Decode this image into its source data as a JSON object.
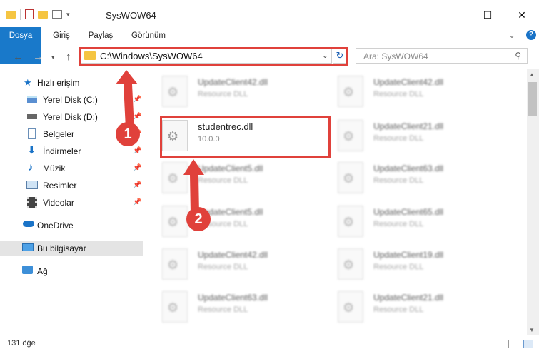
{
  "window": {
    "title": "SysWOW64",
    "minimize_glyph": "—",
    "maximize_glyph": "☐",
    "close_glyph": "✕"
  },
  "ribbon": {
    "tabs": [
      "Dosya",
      "Giriş",
      "Paylaş",
      "Görünüm"
    ],
    "expand_glyph": "⌄",
    "help_glyph": "?"
  },
  "address_bar": {
    "path": "C:\\Windows\\SysWOW64",
    "search_placeholder": "Ara: SysWOW64"
  },
  "sidebar": {
    "items": [
      {
        "label": "Hızlı erişim",
        "icon": "star-icon",
        "pinned": false
      },
      {
        "label": "Yerel Disk (C:)",
        "icon": "drive-icon",
        "pinned": true
      },
      {
        "label": "Yerel Disk (D:)",
        "icon": "drive-icon",
        "pinned": true
      },
      {
        "label": "Belgeler",
        "icon": "documents-icon",
        "pinned": true
      },
      {
        "label": "İndirmeler",
        "icon": "downloads-icon",
        "pinned": true
      },
      {
        "label": "Müzik",
        "icon": "music-icon",
        "pinned": true
      },
      {
        "label": "Resimler",
        "icon": "pictures-icon",
        "pinned": true
      },
      {
        "label": "Videolar",
        "icon": "videos-icon",
        "pinned": true
      },
      {
        "label": "OneDrive",
        "icon": "cloud-icon",
        "pinned": false
      },
      {
        "label": "Bu bilgisayar",
        "icon": "computer-icon",
        "pinned": false
      },
      {
        "label": "Ağ",
        "icon": "network-icon",
        "pinned": false
      }
    ]
  },
  "files": [
    {
      "name": "UpdateClient42.dll",
      "type": "Resource DLL",
      "blurred": true
    },
    {
      "name": "UpdateClient42.dll",
      "type": "Resource DLL",
      "blurred": true
    },
    {
      "name": "studentrec.dll",
      "type": "10.0.0",
      "blurred": false
    },
    {
      "name": "UpdateClient21.dll",
      "type": "Resource DLL",
      "blurred": true
    },
    {
      "name": "UpdateClient5.dll",
      "type": "Resource DLL",
      "blurred": true
    },
    {
      "name": "UpdateClient63.dll",
      "type": "Resource DLL",
      "blurred": true
    },
    {
      "name": "UpdateClient5.dll",
      "type": "Resource DLL",
      "blurred": true
    },
    {
      "name": "UpdateClient65.dll",
      "type": "Resource DLL",
      "blurred": true
    },
    {
      "name": "UpdateClient42.dll",
      "type": "Resource DLL",
      "blurred": true
    },
    {
      "name": "UpdateClient19.dll",
      "type": "Resource DLL",
      "blurred": true
    },
    {
      "name": "UpdateClient63.dll",
      "type": "Resource DLL",
      "blurred": true
    },
    {
      "name": "UpdateClient21.dll",
      "type": "Resource DLL",
      "blurred": true
    }
  ],
  "status": {
    "item_count": "131 öğe"
  },
  "annotations": {
    "step1": "1",
    "step2": "2",
    "highlight_color": "#e0413b"
  },
  "colors": {
    "file_tab": "#1979ca",
    "accent": "#1a73c7"
  }
}
